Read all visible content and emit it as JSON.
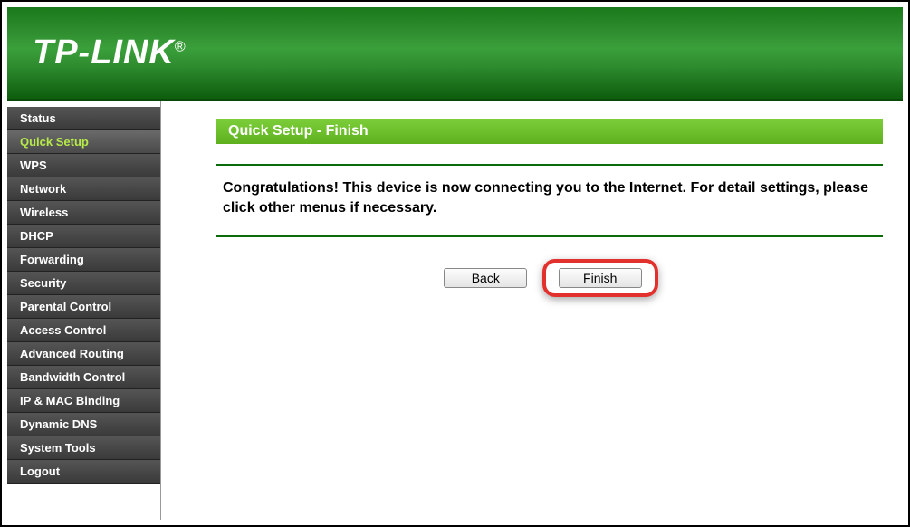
{
  "brand": "TP-LINK",
  "sidebar": {
    "items": [
      {
        "label": "Status",
        "active": false
      },
      {
        "label": "Quick Setup",
        "active": true
      },
      {
        "label": "WPS",
        "active": false
      },
      {
        "label": "Network",
        "active": false
      },
      {
        "label": "Wireless",
        "active": false
      },
      {
        "label": "DHCP",
        "active": false
      },
      {
        "label": "Forwarding",
        "active": false
      },
      {
        "label": "Security",
        "active": false
      },
      {
        "label": "Parental Control",
        "active": false
      },
      {
        "label": "Access Control",
        "active": false
      },
      {
        "label": "Advanced Routing",
        "active": false
      },
      {
        "label": "Bandwidth Control",
        "active": false
      },
      {
        "label": "IP & MAC Binding",
        "active": false
      },
      {
        "label": "Dynamic DNS",
        "active": false
      },
      {
        "label": "System Tools",
        "active": false
      },
      {
        "label": "Logout",
        "active": false
      }
    ]
  },
  "main": {
    "title": "Quick Setup - Finish",
    "message": "Congratulations! This device is now connecting you to the Internet. For detail settings, please click other menus if necessary.",
    "buttons": {
      "back": "Back",
      "finish": "Finish"
    }
  }
}
